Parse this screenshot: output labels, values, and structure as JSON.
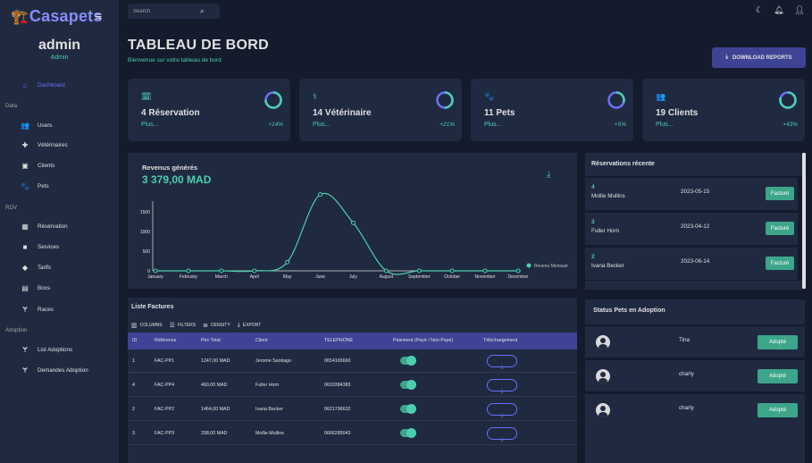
{
  "app": {
    "logo_emoji": "🏗️",
    "logo_text": "Casapets"
  },
  "user": {
    "name": "admin",
    "role": "Admin"
  },
  "nav": {
    "dashboard": "Dashboard",
    "section_data": "Data",
    "users": "Users",
    "veterinaires": "Vétérinaires",
    "clients": "Clients",
    "pets": "Pets",
    "section_rdv": "RDV",
    "reservation": "Résérvation",
    "services": "Services",
    "tarifs": "Tarifs",
    "boxs": "Boxs",
    "races": "Races",
    "section_adoption": "Adoption",
    "list_adoptions": "List Adoptions",
    "demandes_adoption": "Demandes Adoption"
  },
  "search": {
    "placeholder": "Search"
  },
  "header": {
    "title": "TABLEAU DE BORD",
    "subtitle": "Bienvenue sur votre tableau de bord",
    "download_label": "DOWNLOAD REPORTS"
  },
  "stats": [
    {
      "title": "4 Réservation",
      "sub": "Plus...",
      "pct": "+14%",
      "progress": 0.75
    },
    {
      "title": "14 Vétérinaire",
      "sub": "Plus...",
      "pct": "+21%",
      "progress": 0.5
    },
    {
      "title": "11 Pets",
      "sub": "Plus...",
      "pct": "+5%",
      "progress": 0.3
    },
    {
      "title": "19 Clients",
      "sub": "Plus...",
      "pct": "+43%",
      "progress": 0.8
    }
  ],
  "colors": {
    "accent": "#4cceac",
    "primary": "#3e4396",
    "ring_back": "#6870fa",
    "background": "#141b2d",
    "panel": "#1f2a40"
  },
  "revenue": {
    "title": "Revenus générés",
    "value": "3 379,00 MAD",
    "chart_data": {
      "type": "line",
      "categories": [
        "January",
        "February",
        "March",
        "April",
        "May",
        "June",
        "July",
        "August",
        "September",
        "October",
        "November",
        "December"
      ],
      "series": [
        {
          "name": "Revenu Mensuel",
          "values": [
            0,
            0,
            0,
            0,
            220,
            1940,
            1220,
            0,
            0,
            0,
            0,
            0
          ]
        }
      ],
      "yticks": [
        "0",
        "500",
        "1000",
        "1500"
      ],
      "ylim": [
        0,
        2000
      ],
      "legend": "right"
    }
  },
  "reservations": {
    "title": "Réservations récente",
    "items": [
      {
        "id": "4",
        "name": "Mollie Mullins",
        "date": "2023-05-15",
        "status": "Facturé"
      },
      {
        "id": "3",
        "name": "Fuller Horn",
        "date": "2023-04-12",
        "status": "Facturé"
      },
      {
        "id": "2",
        "name": "Ivana Becker",
        "date": "2023-06-14",
        "status": "Facturé"
      }
    ]
  },
  "factures": {
    "title": "Liste Factures",
    "toolbar": {
      "columns": "COLUMNS",
      "filters": "FILTERS",
      "density": "DENSITY",
      "export": "EXPORT"
    },
    "headers": [
      "ID",
      "Référence",
      "Prix Total",
      "Client",
      "TELEPHONE",
      "Paiement (Payé / Non Payé)",
      "Téléchargement"
    ],
    "rows": [
      {
        "id": "1",
        "ref": "FAC-PP1",
        "prix": "1247,00 MAD",
        "client": "Jerome Santiago",
        "tel": "0654165660"
      },
      {
        "id": "4",
        "ref": "FAC-PP4",
        "prix": "460,00 MAD",
        "client": "Fuller Horn",
        "tel": "0610384383"
      },
      {
        "id": "2",
        "ref": "FAC-PP2",
        "prix": "1464,00 MAD",
        "client": "Ivana Becker",
        "tel": "0621796632"
      },
      {
        "id": "3",
        "ref": "FAC-PP3",
        "prix": "208,00 MAD",
        "client": "Mollie Mullins",
        "tel": "0666285043"
      }
    ]
  },
  "adoption": {
    "title": "Status Pets en Adoption",
    "items": [
      {
        "name": "Tina",
        "status": "Adopté"
      },
      {
        "name": "charly",
        "status": "Adopté"
      },
      {
        "name": "charly",
        "status": "Adopté"
      }
    ]
  }
}
